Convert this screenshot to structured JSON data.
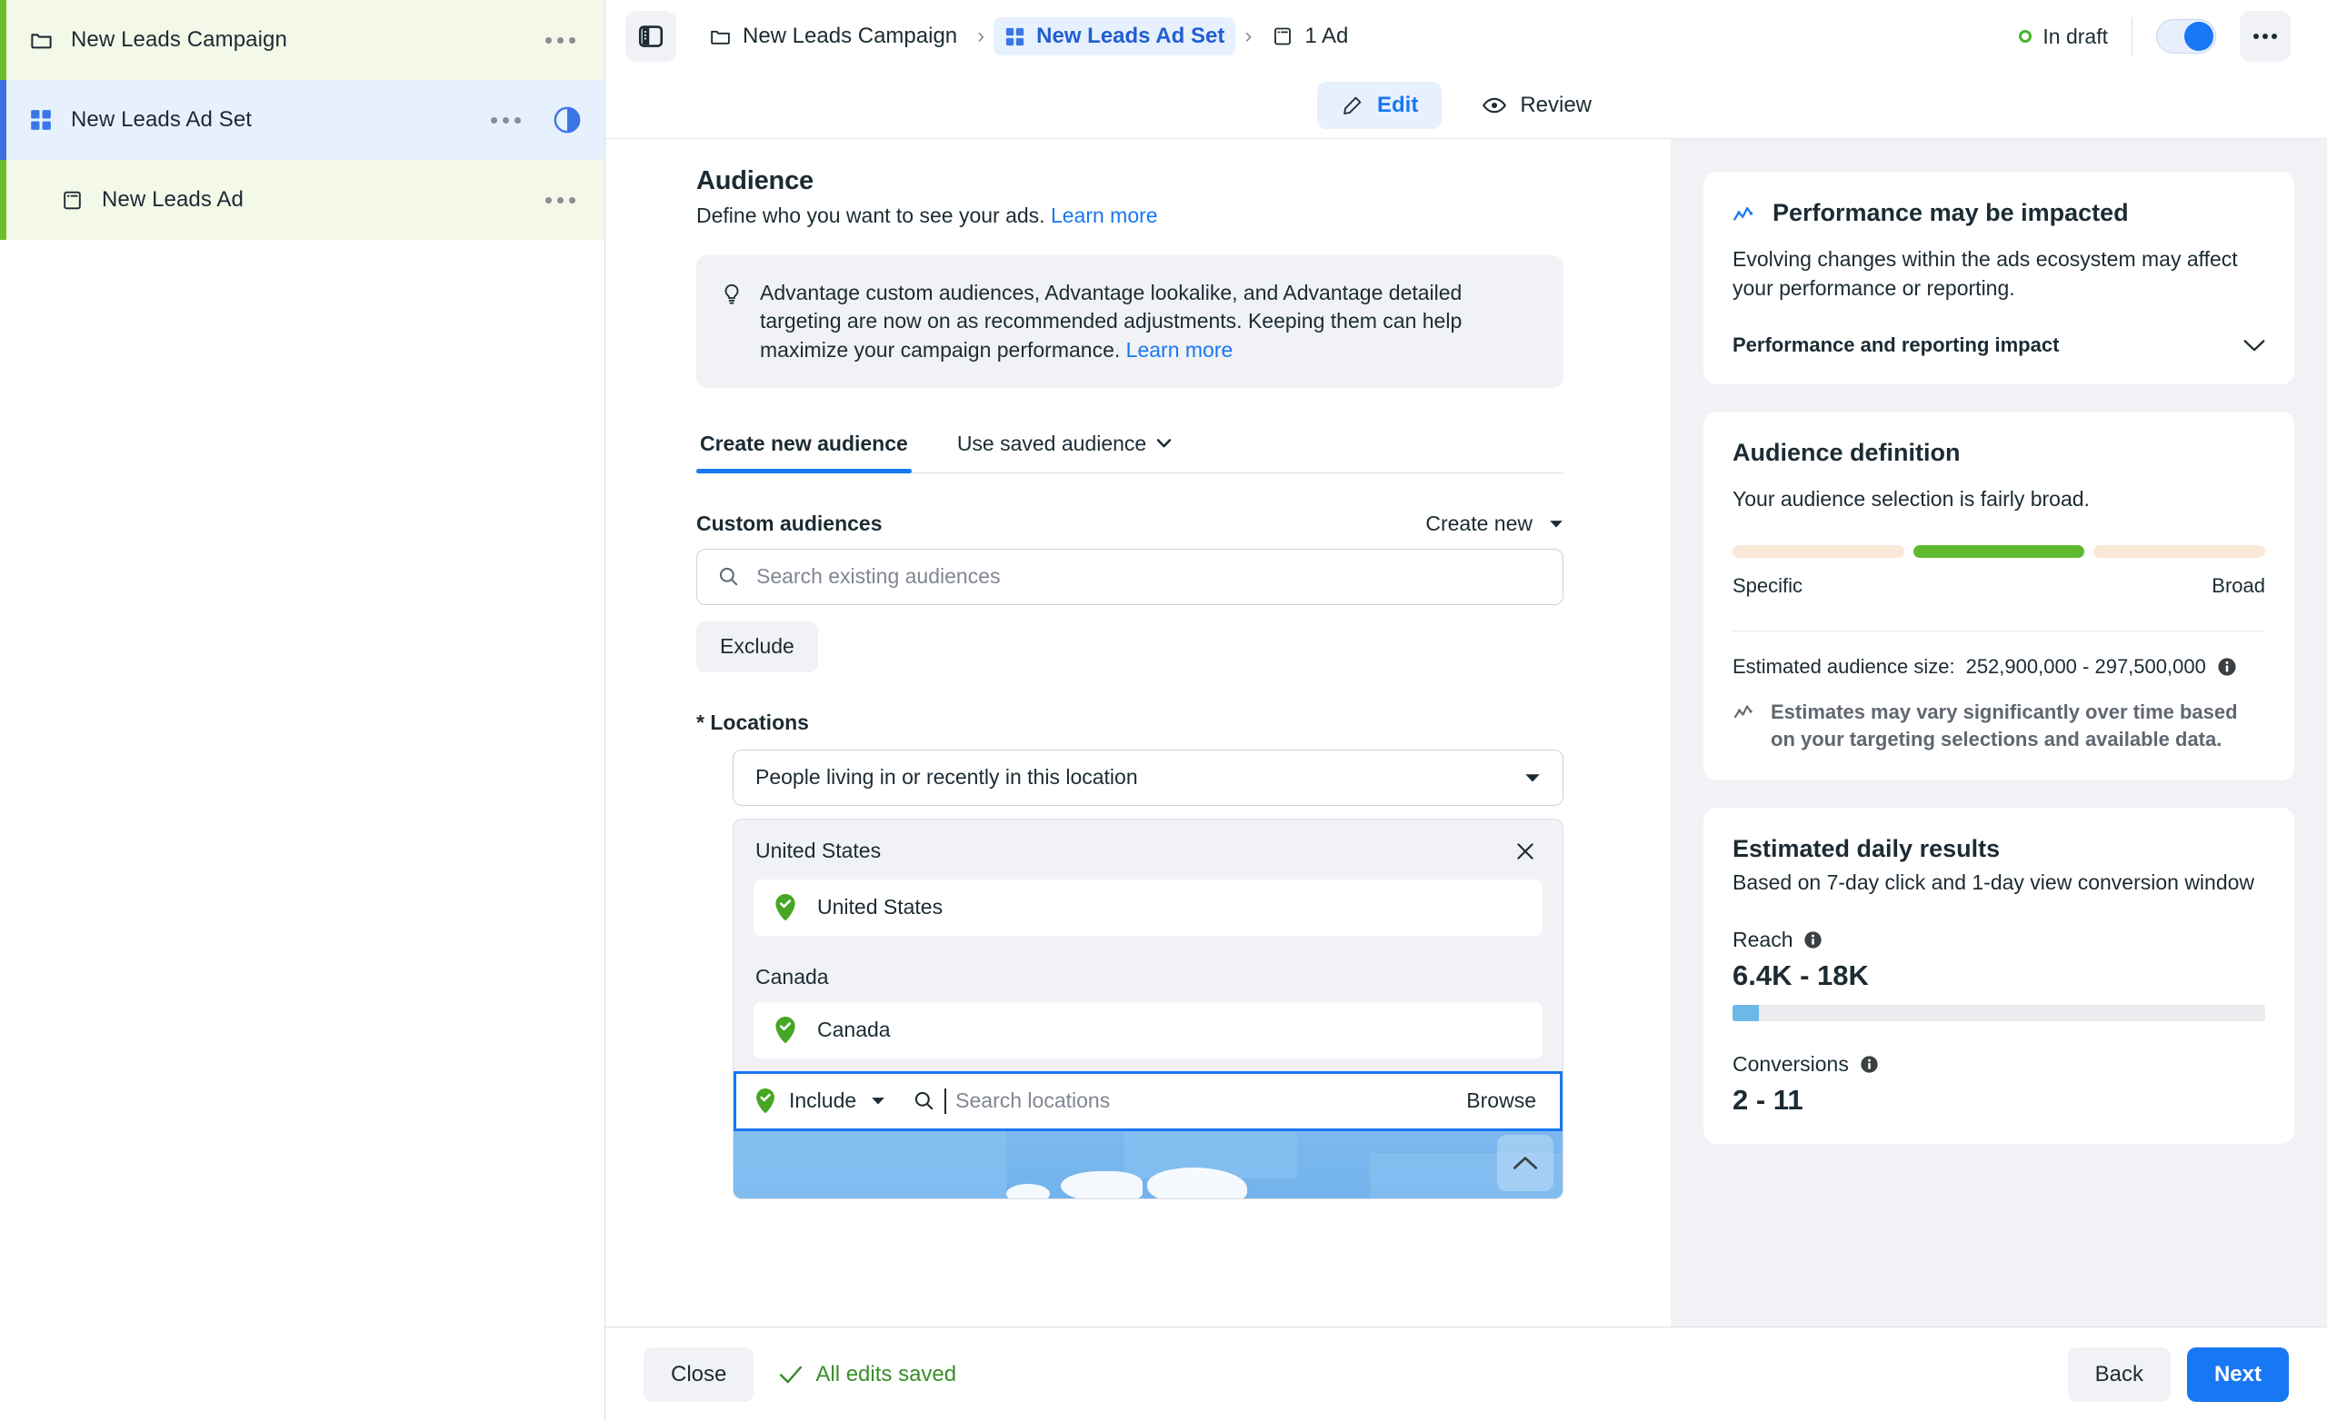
{
  "sidebar": {
    "items": [
      {
        "label": "New Leads Campaign",
        "icon": "folder-icon",
        "level": 0,
        "state": "campaign",
        "menu": "more-options"
      },
      {
        "label": "New Leads Ad Set",
        "icon": "grid-icon",
        "level": 1,
        "state": "adset",
        "menu": "more-options",
        "extra_icon": "contrast-icon"
      },
      {
        "label": "New Leads Ad",
        "icon": "ad-icon",
        "level": 2,
        "state": "ad",
        "menu": "more-options"
      }
    ]
  },
  "header": {
    "panel_toggle_icon": "panel-toggle-icon",
    "breadcrumbs": [
      {
        "label": "New Leads Campaign",
        "icon": "folder-icon",
        "active": false
      },
      {
        "label": "New Leads Ad Set",
        "icon": "grid-icon",
        "active": true
      },
      {
        "label": "1 Ad",
        "icon": "ad-icon",
        "active": false
      }
    ],
    "separator": "›",
    "status_label": "In draft",
    "status_color": "#42b72a",
    "toggle_on": true,
    "more_icon": "more-options-icon"
  },
  "subtabs": [
    {
      "label": "Edit",
      "icon": "pencil-icon",
      "active": true
    },
    {
      "label": "Review",
      "icon": "eye-icon",
      "active": false
    }
  ],
  "audience": {
    "title": "Audience",
    "subtitle": "Define who you want to see your ads.",
    "subtitle_link": "Learn more",
    "notice": {
      "icon": "lightbulb-icon",
      "text": "Advantage custom audiences, Advantage lookalike, and Advantage detailed targeting are now on as recommended adjustments. Keeping them can help maximize your campaign performance.",
      "link": "Learn more"
    },
    "tabs": [
      {
        "label": "Create new audience",
        "active": true,
        "has_caret": false
      },
      {
        "label": "Use saved audience",
        "active": false,
        "has_caret": true
      }
    ],
    "custom_audiences": {
      "label": "Custom audiences",
      "create_new_label": "Create new",
      "search_placeholder": "Search existing audiences",
      "search_value": "",
      "exclude_label": "Exclude"
    },
    "locations": {
      "label": "* Locations",
      "selected_scope": "People living in or recently in this location",
      "groups": [
        {
          "name": "United States",
          "items": [
            {
              "label": "United States",
              "pin": "green-pin-icon"
            }
          ]
        },
        {
          "name": "Canada",
          "items": [
            {
              "label": "Canada",
              "pin": "green-pin-icon"
            }
          ]
        }
      ],
      "include_label": "Include",
      "search_placeholder": "Search locations",
      "search_value": "",
      "browse_label": "Browse",
      "map_collapse_icon": "chevron-up-icon"
    }
  },
  "right_panel": {
    "performance_card": {
      "icon": "trend-line-icon",
      "title": "Performance may be impacted",
      "body": "Evolving changes within the ads ecosystem may affect your performance or reporting.",
      "collapse_label": "Performance and reporting impact",
      "collapse_icon": "chevron-down-icon"
    },
    "audience_definition": {
      "title": "Audience definition",
      "body": "Your audience selection is fairly broad.",
      "meter": {
        "segments": 3,
        "active_index": 1,
        "active_color": "#5dba2e",
        "inactive_color": "#fae8d8"
      },
      "scale_left": "Specific",
      "scale_right": "Broad",
      "estimate_label": "Estimated audience size:",
      "estimate_value": "252,900,000 - 297,500,000",
      "estimate_info_icon": "info-icon",
      "note_icon": "trend-line-icon",
      "note": "Estimates may vary significantly over time based on your targeting selections and available data."
    },
    "estimated_daily_results": {
      "title": "Estimated daily results",
      "subtitle": "Based on 7-day click and 1-day view conversion window",
      "metrics": [
        {
          "label": "Reach",
          "info_icon": "info-icon",
          "value": "6.4K - 18K",
          "bar_percent": 5,
          "bar_color": "#6cb9e8"
        },
        {
          "label": "Conversions",
          "info_icon": "info-icon",
          "value": "2 - 11"
        }
      ]
    }
  },
  "footer": {
    "close_label": "Close",
    "saved_label": "All edits saved",
    "saved_icon": "check-icon",
    "back_label": "Back",
    "next_label": "Next"
  }
}
